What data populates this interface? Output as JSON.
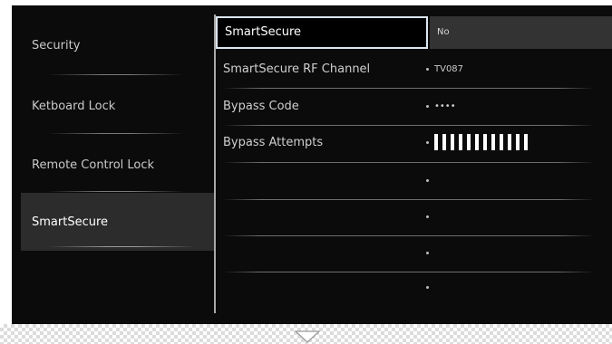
{
  "menu": {
    "items": [
      {
        "label": "Security"
      },
      {
        "label": "Ketboard Lock"
      },
      {
        "label": "Remote Control Lock"
      },
      {
        "label": "SmartSecure"
      }
    ],
    "selected_index": 3
  },
  "list": {
    "focused": {
      "label": "SmartSecure",
      "value": "No"
    },
    "rows": [
      {
        "label": "SmartSecure RF Channel",
        "value": "TV087"
      },
      {
        "label": "Bypass Code",
        "value": "••••"
      },
      {
        "label": "Bypass Attempts",
        "value": ""
      },
      {
        "label": "",
        "value": ""
      },
      {
        "label": "",
        "value": ""
      },
      {
        "label": "",
        "value": ""
      },
      {
        "label": "",
        "value": ""
      }
    ],
    "bypass_attempts_bar_count": 12
  },
  "icons": {
    "scroll_down": "chevron-down-icon",
    "bullet": "bullet-icon"
  },
  "colors": {
    "panel_background": "#0b0b0b",
    "selected_menu_background": "#2c2c2c",
    "focus_border": "#dde6ef",
    "focused_value_background": "#333333"
  }
}
